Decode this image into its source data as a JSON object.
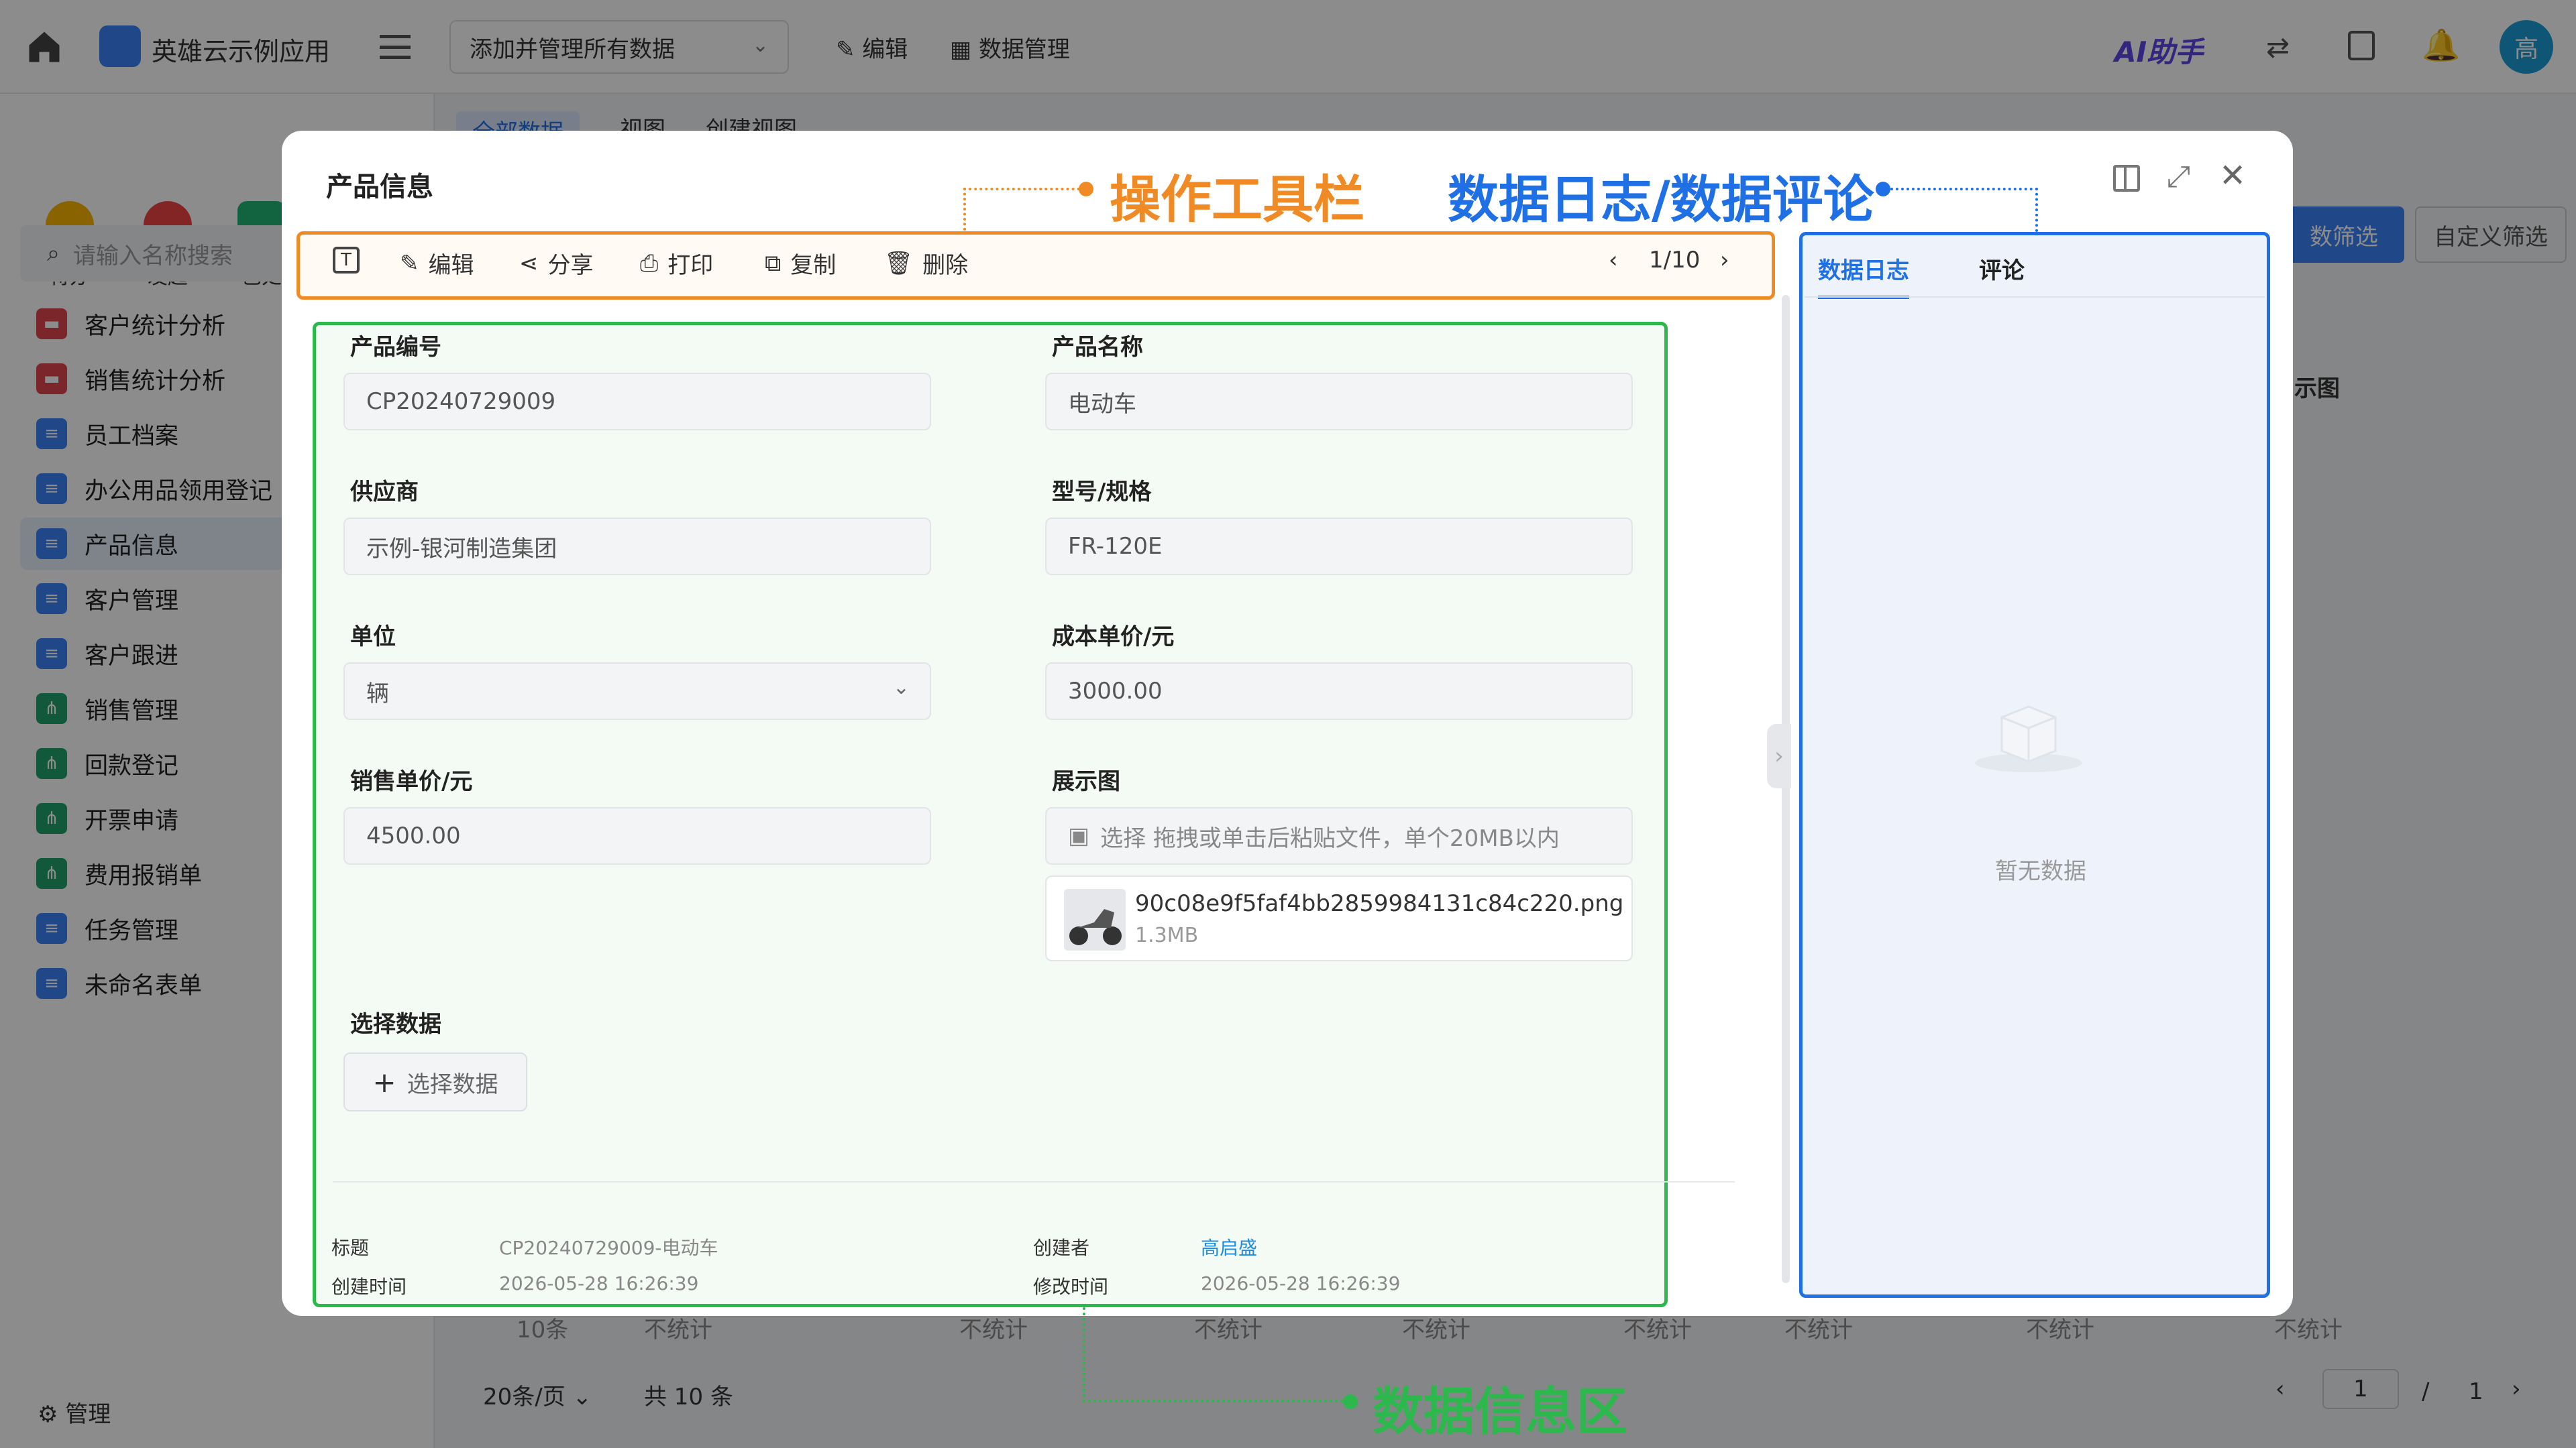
{
  "app": {
    "name": "英雄云示例应用",
    "data_scope": "添加并管理所有数据",
    "edit": "编辑",
    "data_manage": "数据管理",
    "ai": "AI助手",
    "avatar": "高"
  },
  "quick_actions": [
    "待办",
    "发起",
    "已处"
  ],
  "sidebar": {
    "search_placeholder": "请输入名称搜索",
    "items": [
      "客户统计分析",
      "销售统计分析",
      "员工档案",
      "办公用品领用登记",
      "产品信息",
      "客户管理",
      "客户跟进",
      "销售管理",
      "回款登记",
      "开票申请",
      "费用报销单",
      "任务管理",
      "未命名表单"
    ],
    "manage": "管理"
  },
  "background": {
    "tabs": [
      "全部数据",
      "视图",
      "创建视图"
    ],
    "filters": [
      "数筛选",
      "自定义筛选"
    ],
    "column_header": "示图",
    "footer_stats": [
      "10条",
      "不统计",
      "不统计",
      "不统计",
      "不统计",
      "不统计",
      "不统计",
      "不统计",
      "不统计"
    ],
    "page_size": "20条/页",
    "total": "共 10 条",
    "page_current": "1",
    "page_sep": "/",
    "page_total": "1"
  },
  "modal": {
    "title": "产品信息",
    "toolbar": [
      "编辑",
      "分享",
      "打印",
      "复制",
      "删除"
    ],
    "pager": "1/10",
    "side_tabs": [
      "数据日志",
      "评论"
    ],
    "empty": "暂无数据",
    "fields": {
      "product_code": {
        "label": "产品编号",
        "value": "CP20240729009"
      },
      "product_name": {
        "label": "产品名称",
        "value": "电动车"
      },
      "supplier": {
        "label": "供应商",
        "value": "示例-银河制造集团"
      },
      "model": {
        "label": "型号/规格",
        "value": "FR-120E"
      },
      "unit": {
        "label": "单位",
        "value": "辆"
      },
      "cost": {
        "label": "成本单价/元",
        "value": "3000.00"
      },
      "price": {
        "label": "销售单价/元",
        "value": "4500.00"
      },
      "image": {
        "label": "展示图",
        "placeholder": "选择 拖拽或单击后粘贴文件，单个20MB以内",
        "file_name": "90c08e9f5faf4bb2859984131c84c220.png",
        "file_size": "1.3MB"
      },
      "select_data": {
        "label": "选择数据",
        "button": "选择数据"
      }
    },
    "meta": {
      "title_label": "标题",
      "title_value": "CP20240729009-电动车",
      "creator_label": "创建者",
      "creator_value": "高启盛",
      "created_label": "创建时间",
      "created_value": "2026-05-28 16:26:39",
      "modified_label": "修改时间",
      "modified_value": "2026-05-28 16:26:39"
    }
  },
  "annotations": {
    "toolbar": "操作工具栏",
    "side": "数据日志/数据评论",
    "info": "数据信息区"
  },
  "colors": {
    "orange": "#f08a24",
    "blue": "#1f6fe5",
    "green": "#2db84d",
    "accent": "#3b82f6"
  }
}
